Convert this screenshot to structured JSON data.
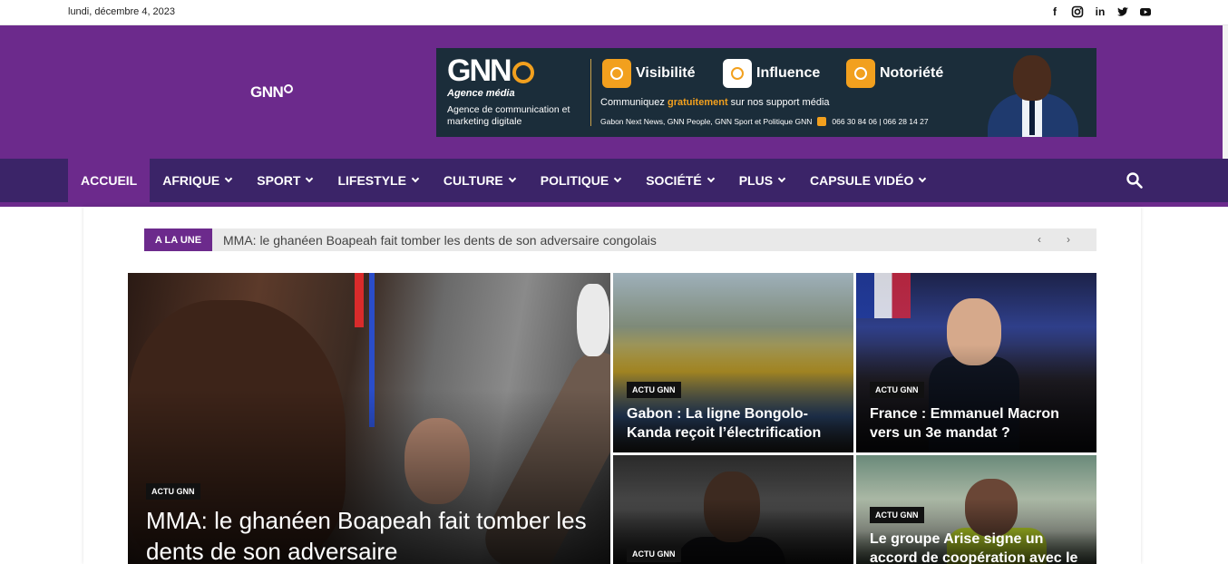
{
  "topbar": {
    "date": "lundi, décembre 4, 2023",
    "social_icons": [
      "facebook-icon",
      "instagram-icon",
      "linkedin-icon",
      "twitter-icon",
      "youtube-icon"
    ]
  },
  "header": {
    "logo_text": "GNN",
    "background_color": "#6c2a8c",
    "banner": {
      "logo": "GNN",
      "subtitle": "Agence média",
      "description": "Agence de communication et marketing digitale",
      "pillars": [
        "Visibilité",
        "Influence",
        "Notoriété"
      ],
      "line_prefix": "Communiquez ",
      "line_highlight": "gratuitement",
      "line_suffix": " sur nos support média",
      "footer_sites": "Gabon Next News, GNN People, GNN Sport et Politique GNN",
      "footer_phones": "066 30 84 06 | 066 28 14 27"
    }
  },
  "nav": {
    "background_color": "#3b2468",
    "items": [
      {
        "label": "ACCUEIL",
        "active": true,
        "dropdown": false
      },
      {
        "label": "AFRIQUE",
        "active": false,
        "dropdown": true
      },
      {
        "label": "SPORT",
        "active": false,
        "dropdown": true
      },
      {
        "label": "LIFESTYLE",
        "active": false,
        "dropdown": true
      },
      {
        "label": "CULTURE",
        "active": false,
        "dropdown": true
      },
      {
        "label": "POLITIQUE",
        "active": false,
        "dropdown": true
      },
      {
        "label": "SOCIÉTÉ",
        "active": false,
        "dropdown": true
      },
      {
        "label": "PLUS",
        "active": false,
        "dropdown": true
      },
      {
        "label": "CAPSULE VIDÉO",
        "active": false,
        "dropdown": true
      }
    ]
  },
  "ticker": {
    "tag": "A LA UNE",
    "headline": "MMA: le ghanéen Boapeah fait tomber les dents de son adversaire congolais",
    "prev": "‹",
    "next": "›"
  },
  "articles": [
    {
      "category": "ACTU GNN",
      "title": "MMA: le ghanéen Boapeah fait tomber les dents de son adversaire"
    },
    {
      "category": "ACTU GNN",
      "title": "Gabon : La ligne Bongolo-Kanda reçoit l’électrification"
    },
    {
      "category": "ACTU GNN",
      "title": "France : Emmanuel Macron vers un 3e mandat ?"
    },
    {
      "category": "ACTU GNN",
      "title": ""
    },
    {
      "category": "ACTU GNN",
      "title": "Le groupe Arise signe un accord de coopération avec le ministère"
    }
  ]
}
